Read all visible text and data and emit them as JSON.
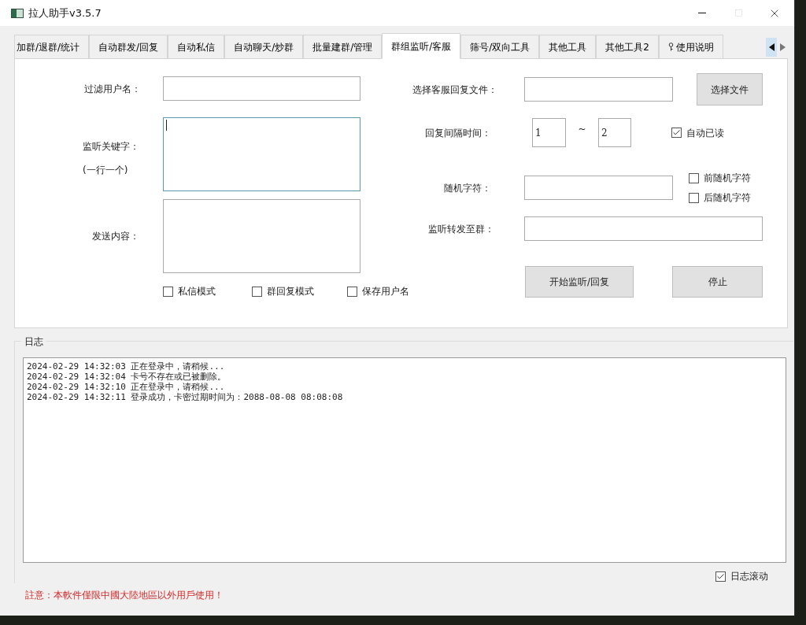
{
  "window": {
    "title": "拉人助手v3.5.7",
    "maximize_disabled": true
  },
  "tabs": [
    {
      "label": "加群/退群/统计",
      "selected": false,
      "kind": "tool"
    },
    {
      "label": "自动群发/回复",
      "selected": false,
      "kind": "tool"
    },
    {
      "label": "自动私信",
      "selected": false,
      "kind": "tool"
    },
    {
      "label": "自动聊天/炒群",
      "selected": false,
      "kind": "tool"
    },
    {
      "label": "批量建群/管理",
      "selected": false,
      "kind": "tool"
    },
    {
      "label": "群组监听/客服",
      "selected": true,
      "kind": "tool"
    },
    {
      "label": "筛号/双向工具",
      "selected": false,
      "kind": "tool"
    },
    {
      "label": "其他工具",
      "selected": false,
      "kind": "tool"
    },
    {
      "label": "其他工具2",
      "selected": false,
      "kind": "tool"
    },
    {
      "label": "使用说明",
      "selected": false,
      "kind": "guide"
    }
  ],
  "left_form": {
    "filter_username": {
      "label": "过滤用户名："
    },
    "keywords": {
      "label": "监听关键字：",
      "hint": "(一行一个)",
      "focused": true
    },
    "send_content": {
      "label": "发送内容："
    },
    "checkboxes": [
      {
        "label": "私信模式",
        "checked": false
      },
      {
        "label": "群回复模式",
        "checked": false
      },
      {
        "label": "保存用户名",
        "checked": false
      }
    ]
  },
  "right_form": {
    "reply_file": {
      "label": "选择客服回复文件：",
      "button": "选择文件"
    },
    "interval": {
      "label": "回复间隔时间：",
      "from": "1",
      "separator": "~",
      "to": "2",
      "auto_read": {
        "label": "自动已读",
        "checked": true
      }
    },
    "random_chars": {
      "label": "随机字符：",
      "options": [
        {
          "label": "前随机字符",
          "checked": false
        },
        {
          "label": "后随机字符",
          "checked": false
        }
      ]
    },
    "forward_group": {
      "label": "监听转发至群："
    },
    "buttons": [
      "开始监听/回复",
      "停止"
    ]
  },
  "log": {
    "title": "日志",
    "lines": [
      "2024-02-29 14:32:03 正在登录中，请稍候...",
      "2024-02-29 14:32:04 卡号不存在或已被删除。",
      "2024-02-29 14:32:10 正在登录中，请稍候...",
      "2024-02-29 14:32:11 登录成功，卡密过期时间为：2088-08-08 08:08:08"
    ],
    "auto_scroll": {
      "label": "日志滚动",
      "checked": true
    }
  },
  "notice": "註意：本軟件僅限中國大陸地區以外用戶使用！"
}
